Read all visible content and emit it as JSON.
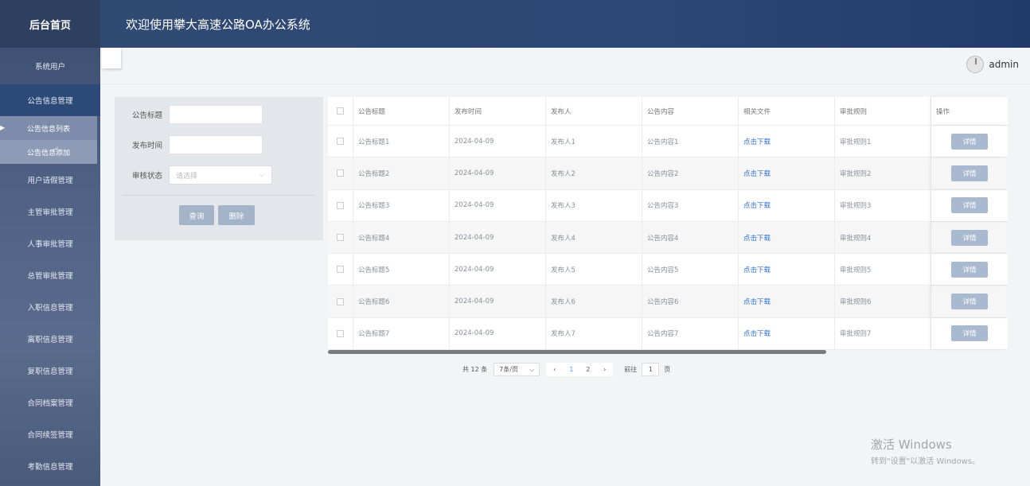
{
  "sidebar": {
    "logo": "后台首页",
    "users": "系统用户",
    "notice_group": "公告信息管理",
    "sub_items": [
      "公告信息列表",
      "公告信息添加"
    ],
    "items": [
      "用户请假管理",
      "主管审批管理",
      "人事审批管理",
      "总管审批管理",
      "入职信息管理",
      "离职信息管理",
      "复职信息管理",
      "合同档案管理",
      "合同续签管理",
      "考勤信息管理"
    ]
  },
  "header": {
    "title": "欢迎使用攀大高速公路OA办公系统"
  },
  "topbar": {
    "username": "admin"
  },
  "search": {
    "title_label": "公告标题",
    "time_label": "发布时间",
    "status_label": "审核状态",
    "status_placeholder": "请选择",
    "query_button": "查询",
    "delete_button": "删除"
  },
  "table": {
    "headers": [
      "公告标题",
      "发布时间",
      "发布人",
      "公告内容",
      "相关文件",
      "审批规则",
      "操作"
    ],
    "rows": [
      [
        "公告标题1",
        "2024-04-09",
        "发布人1",
        "公告内容1",
        "点击下载",
        "审批规则1",
        "详情"
      ],
      [
        "公告标题2",
        "2024-04-09",
        "发布人2",
        "公告内容2",
        "点击下载",
        "审批规则2",
        "详情"
      ],
      [
        "公告标题3",
        "2024-04-09",
        "发布人3",
        "公告内容3",
        "点击下载",
        "审批规则3",
        "详情"
      ],
      [
        "公告标题4",
        "2024-04-09",
        "发布人4",
        "公告内容4",
        "点击下载",
        "审批规则4",
        "详情"
      ],
      [
        "公告标题5",
        "2024-04-09",
        "发布人5",
        "公告内容5",
        "点击下载",
        "审批规则5",
        "详情"
      ],
      [
        "公告标题6",
        "2024-04-09",
        "发布人6",
        "公告内容6",
        "点击下载",
        "审批规则6",
        "详情"
      ],
      [
        "公告标题7",
        "2024-04-09",
        "发布人7",
        "公告内容7",
        "点击下载",
        "审批规则7",
        "详情"
      ]
    ]
  },
  "pagination": {
    "total": "共 12 条",
    "page_size": "7条/页",
    "pages": [
      "1",
      "2"
    ],
    "current_page": "1",
    "goto_label": "前往",
    "goto_value": "1",
    "page_unit": "页"
  },
  "watermark": {
    "line1": "激活 Windows",
    "line2": "转到\"设置\"以激活 Windows。"
  }
}
